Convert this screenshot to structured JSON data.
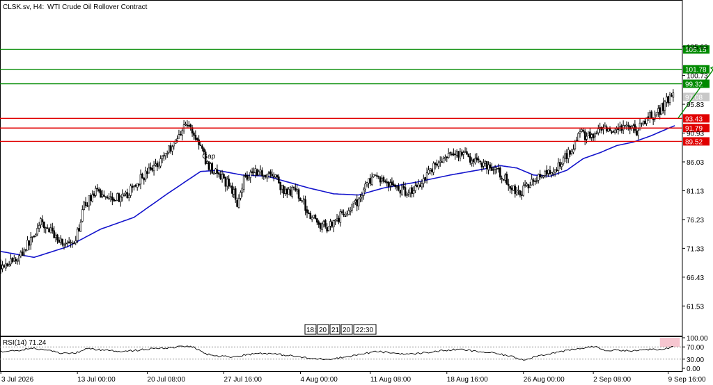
{
  "header": {
    "symbol": "CLSK.sv, H4:",
    "instrument": "WTI Crude Oil Rollover Contract"
  },
  "colors": {
    "candle_up": "#000000",
    "candle_down": "#000000",
    "moving_average": "#1414cc",
    "resistance": "#008a00",
    "support": "#e00000",
    "arrow": "#008a00",
    "grid_frame": "#000000",
    "current_price_badge": "#c8c8c8",
    "rsi_line": "#000000",
    "rsi_highlight": "#f6c6d0"
  },
  "session_markers": [
    "18:",
    "20",
    "21",
    "20",
    "22:30"
  ],
  "annotations": {
    "gap_label": "Gap"
  },
  "chart_data": [
    {
      "type": "candlestick",
      "title": "",
      "ylim": [
        56.6,
        111.2
      ],
      "y_tick_labels": [
        {
          "value": 105.63,
          "label": "105.63"
        },
        {
          "value": 100.73,
          "label": "100.73"
        },
        {
          "value": 95.83,
          "label": "95.83"
        },
        {
          "value": 90.93,
          "label": "90.93"
        },
        {
          "value": 86.03,
          "label": "86.03"
        },
        {
          "value": 81.13,
          "label": "81.13"
        },
        {
          "value": 76.23,
          "label": "76.23"
        },
        {
          "value": 71.33,
          "label": "71.33"
        },
        {
          "value": 66.43,
          "label": "66.43"
        },
        {
          "value": 61.53,
          "label": "61.53"
        }
      ],
      "x_tick_labels": [
        {
          "index": 0,
          "label": "3 Jul 2026"
        },
        {
          "index": 46,
          "label": "13 Jul 00:00"
        },
        {
          "index": 88,
          "label": "20 Jul 08:00"
        },
        {
          "index": 134,
          "label": "27 Jul 16:00"
        },
        {
          "index": 180,
          "label": "4 Aug 00:00"
        },
        {
          "index": 222,
          "label": "11 Aug 08:00"
        },
        {
          "index": 268,
          "label": "18 Aug 16:00"
        },
        {
          "index": 314,
          "label": "26 Aug 00:00"
        },
        {
          "index": 356,
          "label": "2 Sep 08:00"
        },
        {
          "index": 401,
          "label": "9 Sep 16:00"
        }
      ],
      "close_anchors": [
        [
          0,
          68.5
        ],
        [
          10,
          69.5
        ],
        [
          18,
          72.8
        ],
        [
          24,
          75.6
        ],
        [
          30,
          74.2
        ],
        [
          38,
          72.2
        ],
        [
          44,
          71.5
        ],
        [
          50,
          78.5
        ],
        [
          56,
          80.8
        ],
        [
          66,
          80.2
        ],
        [
          74,
          79.8
        ],
        [
          84,
          83.2
        ],
        [
          92,
          85.2
        ],
        [
          100,
          87.8
        ],
        [
          106,
          90.0
        ],
        [
          110,
          92.5
        ],
        [
          114,
          91.8
        ],
        [
          120,
          88.6
        ],
        [
          124,
          85.6
        ],
        [
          128,
          84.6
        ],
        [
          134,
          82.8
        ],
        [
          138,
          82.0
        ],
        [
          142,
          79.2
        ],
        [
          146,
          83.2
        ],
        [
          152,
          84.8
        ],
        [
          156,
          84.2
        ],
        [
          162,
          84.0
        ],
        [
          166,
          83.2
        ],
        [
          170,
          80.6
        ],
        [
          176,
          81.2
        ],
        [
          180,
          80.2
        ],
        [
          184,
          77.8
        ],
        [
          190,
          75.6
        ],
        [
          196,
          75.0
        ],
        [
          200,
          76.0
        ],
        [
          206,
          77.2
        ],
        [
          214,
          79.0
        ],
        [
          220,
          82.6
        ],
        [
          226,
          83.4
        ],
        [
          232,
          82.6
        ],
        [
          238,
          81.6
        ],
        [
          244,
          81.0
        ],
        [
          250,
          81.6
        ],
        [
          256,
          84.2
        ],
        [
          262,
          85.8
        ],
        [
          268,
          86.6
        ],
        [
          274,
          87.6
        ],
        [
          280,
          87.0
        ],
        [
          286,
          86.0
        ],
        [
          292,
          85.6
        ],
        [
          298,
          84.4
        ],
        [
          304,
          82.8
        ],
        [
          310,
          80.6
        ],
        [
          316,
          81.6
        ],
        [
          320,
          83.4
        ],
        [
          326,
          83.6
        ],
        [
          332,
          84.2
        ],
        [
          338,
          86.6
        ],
        [
          344,
          88.8
        ],
        [
          348,
          91.0
        ],
        [
          352,
          90.4
        ],
        [
          356,
          90.2
        ],
        [
          362,
          91.6
        ],
        [
          368,
          90.4
        ],
        [
          372,
          91.6
        ],
        [
          378,
          92.0
        ],
        [
          382,
          91.2
        ],
        [
          388,
          93.4
        ],
        [
          394,
          94.2
        ],
        [
          398,
          95.5
        ],
        [
          402,
          97.0
        ],
        [
          404,
          97.6
        ]
      ],
      "levels": [
        {
          "value": 105.15,
          "label": "105.15",
          "kind": "resistance"
        },
        {
          "value": 101.78,
          "label": "101.78",
          "kind": "resistance"
        },
        {
          "value": 99.32,
          "label": "99.32",
          "kind": "resistance"
        },
        {
          "value": 93.43,
          "label": "93.43",
          "kind": "support"
        },
        {
          "value": 91.79,
          "label": "91.79",
          "kind": "support"
        },
        {
          "value": 89.52,
          "label": "89.52",
          "kind": "support"
        }
      ],
      "current_price": {
        "value": 97.08,
        "label": "97.08"
      },
      "moving_average": {
        "name": "",
        "anchors": [
          [
            0,
            70.8
          ],
          [
            20,
            69.8
          ],
          [
            40,
            71.6
          ],
          [
            60,
            74.6
          ],
          [
            80,
            76.6
          ],
          [
            100,
            80.6
          ],
          [
            120,
            84.4
          ],
          [
            130,
            84.6
          ],
          [
            145,
            83.8
          ],
          [
            160,
            83.6
          ],
          [
            170,
            82.8
          ],
          [
            185,
            81.6
          ],
          [
            200,
            80.6
          ],
          [
            215,
            80.4
          ],
          [
            230,
            81.6
          ],
          [
            250,
            82.6
          ],
          [
            270,
            83.8
          ],
          [
            290,
            84.8
          ],
          [
            300,
            85.4
          ],
          [
            310,
            85.0
          ],
          [
            320,
            83.8
          ],
          [
            330,
            83.6
          ],
          [
            340,
            84.6
          ],
          [
            350,
            86.6
          ],
          [
            360,
            87.6
          ],
          [
            370,
            88.8
          ],
          [
            380,
            89.4
          ],
          [
            390,
            90.4
          ],
          [
            400,
            91.6
          ],
          [
            405,
            92.2
          ]
        ]
      },
      "arrow": {
        "from": [
          407,
          93.5
        ],
        "to": [
          430,
          102.5
        ]
      },
      "gap_annotation": {
        "index": 121,
        "value": 86.6
      }
    },
    {
      "type": "line",
      "title": "",
      "label": "RSI(14) 71.24",
      "ylim": [
        0,
        100
      ],
      "y_tick_labels": [
        {
          "value": 100,
          "label": "100.00"
        },
        {
          "value": 70,
          "label": "70.00"
        },
        {
          "value": 30,
          "label": "30.00"
        },
        {
          "value": 0,
          "label": "0.00"
        }
      ],
      "reference_levels": [
        70,
        30
      ],
      "highlight_range": {
        "from_index": 396,
        "to_index": 408,
        "from_value": 70,
        "to_value": 100
      },
      "anchors": [
        [
          0,
          55
        ],
        [
          10,
          58
        ],
        [
          20,
          66
        ],
        [
          28,
          58
        ],
        [
          36,
          50
        ],
        [
          44,
          48
        ],
        [
          52,
          65
        ],
        [
          60,
          60
        ],
        [
          70,
          56
        ],
        [
          80,
          58
        ],
        [
          90,
          64
        ],
        [
          100,
          66
        ],
        [
          110,
          72
        ],
        [
          116,
          70
        ],
        [
          122,
          48
        ],
        [
          130,
          40
        ],
        [
          140,
          38
        ],
        [
          148,
          45
        ],
        [
          156,
          50
        ],
        [
          166,
          46
        ],
        [
          176,
          40
        ],
        [
          186,
          32
        ],
        [
          196,
          30
        ],
        [
          206,
          36
        ],
        [
          216,
          46
        ],
        [
          226,
          55
        ],
        [
          236,
          50
        ],
        [
          246,
          46
        ],
        [
          256,
          52
        ],
        [
          266,
          58
        ],
        [
          276,
          62
        ],
        [
          286,
          55
        ],
        [
          296,
          50
        ],
        [
          306,
          40
        ],
        [
          314,
          28
        ],
        [
          322,
          40
        ],
        [
          330,
          48
        ],
        [
          340,
          58
        ],
        [
          350,
          66
        ],
        [
          356,
          72
        ],
        [
          364,
          58
        ],
        [
          372,
          60
        ],
        [
          380,
          56
        ],
        [
          388,
          62
        ],
        [
          396,
          60
        ],
        [
          404,
          71
        ]
      ]
    }
  ]
}
